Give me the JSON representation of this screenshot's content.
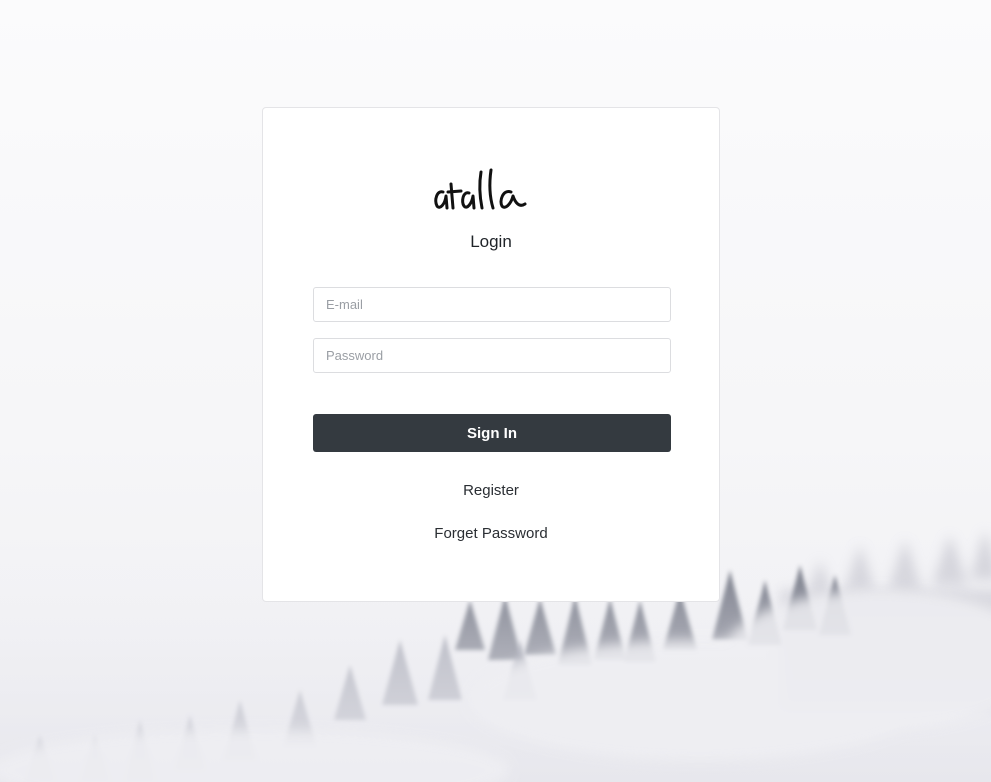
{
  "brand": {
    "logo_text": "atalla"
  },
  "login": {
    "title": "Login",
    "email_placeholder": "E-mail",
    "password_placeholder": "Password",
    "signin_label": "Sign In",
    "register_label": "Register",
    "forgot_label": "Forget Password"
  }
}
